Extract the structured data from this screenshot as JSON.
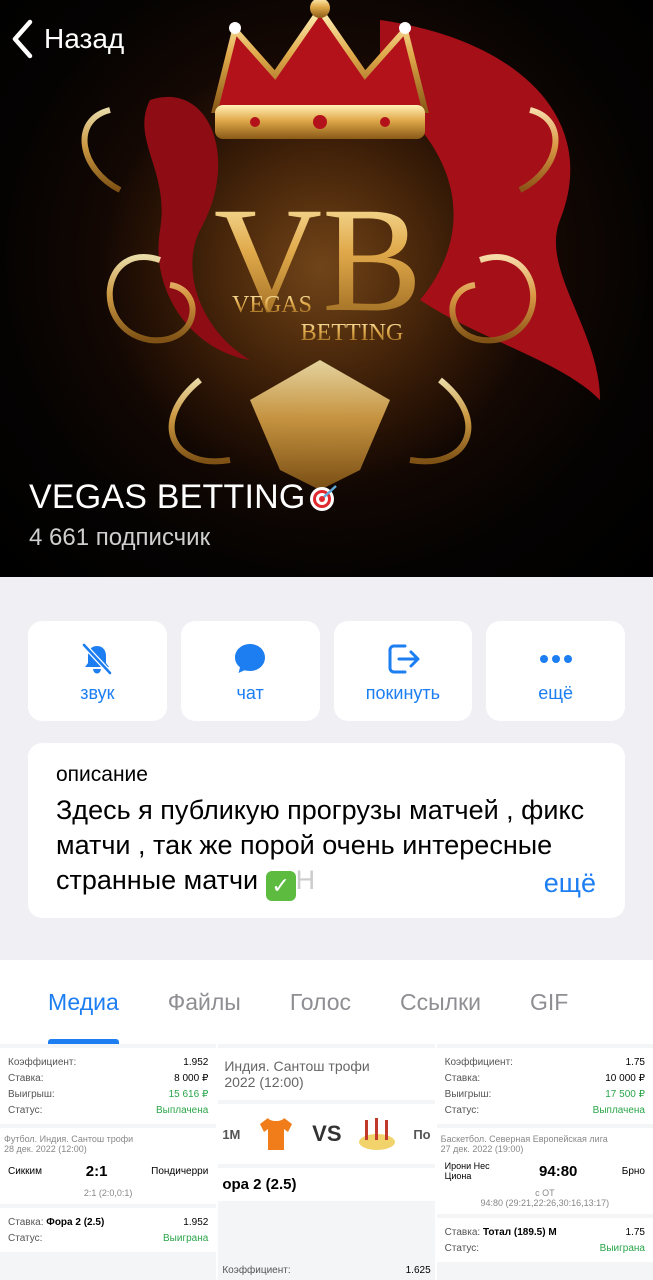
{
  "nav": {
    "back_label": "Назад"
  },
  "channel": {
    "title": "VEGAS BETTING",
    "subscribers": "4 661 подписчик",
    "logo_text_main": "VB",
    "logo_text_sub1": "VEGAS",
    "logo_text_sub2": "BETTING"
  },
  "actions": [
    {
      "label": "звук",
      "icon": "bell-slash-icon"
    },
    {
      "label": "чат",
      "icon": "chat-bubble-icon"
    },
    {
      "label": "покинуть",
      "icon": "leave-icon"
    },
    {
      "label": "ещё",
      "icon": "more-icon"
    }
  ],
  "description": {
    "heading": "описание",
    "text": "Здесь я публикую прогрузы матчей , фикс матчи , так же порой очень интересные странные матчи ",
    "more_label": "ещё"
  },
  "tabs": [
    "Медиа",
    "Файлы",
    "Голос",
    "Ссылки",
    "GIF"
  ],
  "active_tab": "Медиа",
  "media": {
    "thumb1": {
      "rows": [
        {
          "k": "Коэффициент:",
          "v": "1.952"
        },
        {
          "k": "Ставка:",
          "v": "8 000 ₽"
        },
        {
          "k": "Выигрыш:",
          "v": "15 616 ₽"
        },
        {
          "k": "Статус:",
          "v": "Выплачена"
        }
      ],
      "league": "Футбол. Индия. Сантош трофи",
      "date": "28 дек. 2022 (12:00)",
      "team1": "Сикким",
      "score": "2:1",
      "team2": "Пондичерри",
      "periods": "2:1 (2:0,0:1)",
      "bet_label": "Ставка:",
      "bet": "Фора 2 (2.5)",
      "bet_odds": "1.952",
      "status_label": "Статус:",
      "status": "Выиграна"
    },
    "thumb2": {
      "league": "Индия. Сантош трофи",
      "date": "2022 (12:00)",
      "left": "1М",
      "vs": "VS",
      "right": "По",
      "bet": "ора 2 (2.5)",
      "bottom_k": "Коэффициент:",
      "bottom_v": "1.625"
    },
    "thumb3": {
      "rows": [
        {
          "k": "Коэффициент:",
          "v": "1.75"
        },
        {
          "k": "Ставка:",
          "v": "10 000 ₽"
        },
        {
          "k": "Выигрыш:",
          "v": "17 500 ₽"
        },
        {
          "k": "Статус:",
          "v": "Выплачена"
        }
      ],
      "league": "Баскетбол. Северная Европейская лига",
      "date": "27 дек. 2022 (19:00)",
      "team1": "Ирони Нес Циона",
      "score": "94:80",
      "team2": "Брно",
      "note": "с ОТ",
      "periods": "94:80 (29:21,22:26,30:16,13:17)",
      "bet_label": "Ставка:",
      "bet": "Тотал (189.5) М",
      "bet_odds": "1.75",
      "status_label": "Статус:",
      "status": "Выиграна"
    }
  },
  "colors": {
    "accent": "#1d7ef2",
    "gold": "#d9a441",
    "red": "#b3121b"
  }
}
